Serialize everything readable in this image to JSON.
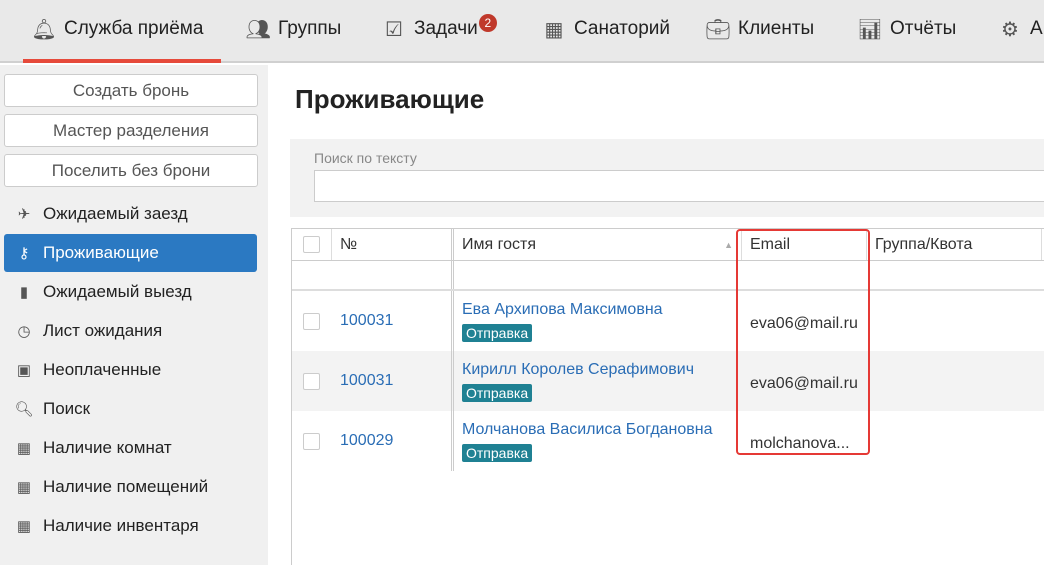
{
  "topnav": {
    "items": [
      {
        "label": "Служба приёма",
        "icon": "bell-icon"
      },
      {
        "label": "Группы",
        "icon": "users-icon"
      },
      {
        "label": "Задачи",
        "icon": "calendar-check-icon",
        "badge": "2"
      },
      {
        "label": "Санаторий",
        "icon": "building-icon"
      },
      {
        "label": "Клиенты",
        "icon": "briefcase-icon"
      },
      {
        "label": "Отчёты",
        "icon": "bar-chart-icon"
      },
      {
        "label": "А",
        "icon": "gears-icon"
      }
    ]
  },
  "sidebar": {
    "buttons": [
      "Создать бронь",
      "Мастер разделения",
      "Поселить без брони"
    ],
    "items": [
      {
        "label": "Ожидаемый заезд",
        "icon": "plane-icon"
      },
      {
        "label": "Проживающие",
        "icon": "key-icon",
        "active": true
      },
      {
        "label": "Ожидаемый выезд",
        "icon": "suitcase-icon"
      },
      {
        "label": "Лист ожидания",
        "icon": "clock-icon"
      },
      {
        "label": "Неоплаченные",
        "icon": "money-icon"
      },
      {
        "label": "Поиск",
        "icon": "search-icon"
      },
      {
        "label": "Наличие комнат",
        "icon": "grid-icon"
      },
      {
        "label": "Наличие помещений",
        "icon": "grid-icon"
      },
      {
        "label": "Наличие инвентаря",
        "icon": "grid-icon"
      }
    ]
  },
  "main": {
    "title": "Проживающие",
    "search": {
      "label": "Поиск по тексту",
      "value": ""
    },
    "table": {
      "headers": [
        "№",
        "Имя гостя",
        "Email",
        "Группа/Квота"
      ],
      "rows": [
        {
          "num": "100031",
          "name": "Ева Архипова Максимовна",
          "tag": "Отправка",
          "email": "eva06@mail.ru",
          "group": ""
        },
        {
          "num": "100031",
          "name": "Кирилл Королев Серафимович",
          "tag": "Отправка",
          "email": "eva06@mail.ru",
          "group": ""
        },
        {
          "num": "100029",
          "name": "Молчанова Василиса Богдановна",
          "tag": "Отправка",
          "email": "molchanova...",
          "group": ""
        }
      ]
    }
  },
  "colors": {
    "accent": "#2b79c2",
    "active_tab": "#e64a3b",
    "tag": "#1f8193",
    "highlight": "#e53935"
  }
}
